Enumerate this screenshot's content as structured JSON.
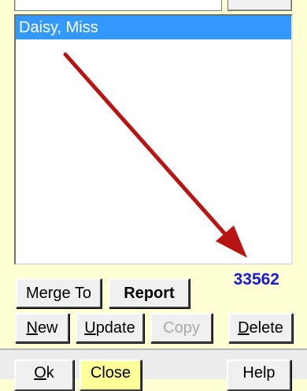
{
  "list": {
    "items": [
      {
        "label": "Daisy, Miss",
        "selected": true
      }
    ]
  },
  "record_count": "33562",
  "buttons": {
    "merge_to": "Merge To",
    "report": "Report",
    "new": {
      "first": "N",
      "rest": "ew"
    },
    "update": {
      "first": "U",
      "rest": "pdate"
    },
    "copy": "Copy",
    "delete": {
      "first": "D",
      "rest": "elete"
    }
  },
  "dialog_buttons": {
    "ok": {
      "first": "O",
      "rest": "k"
    },
    "close": "Close",
    "help": "Help"
  },
  "colors": {
    "panel_background": "#ffffd4",
    "selection": "#3399ff",
    "count_text": "#1818d6",
    "arrow": "#b81414",
    "close_button": "#ffff99"
  }
}
